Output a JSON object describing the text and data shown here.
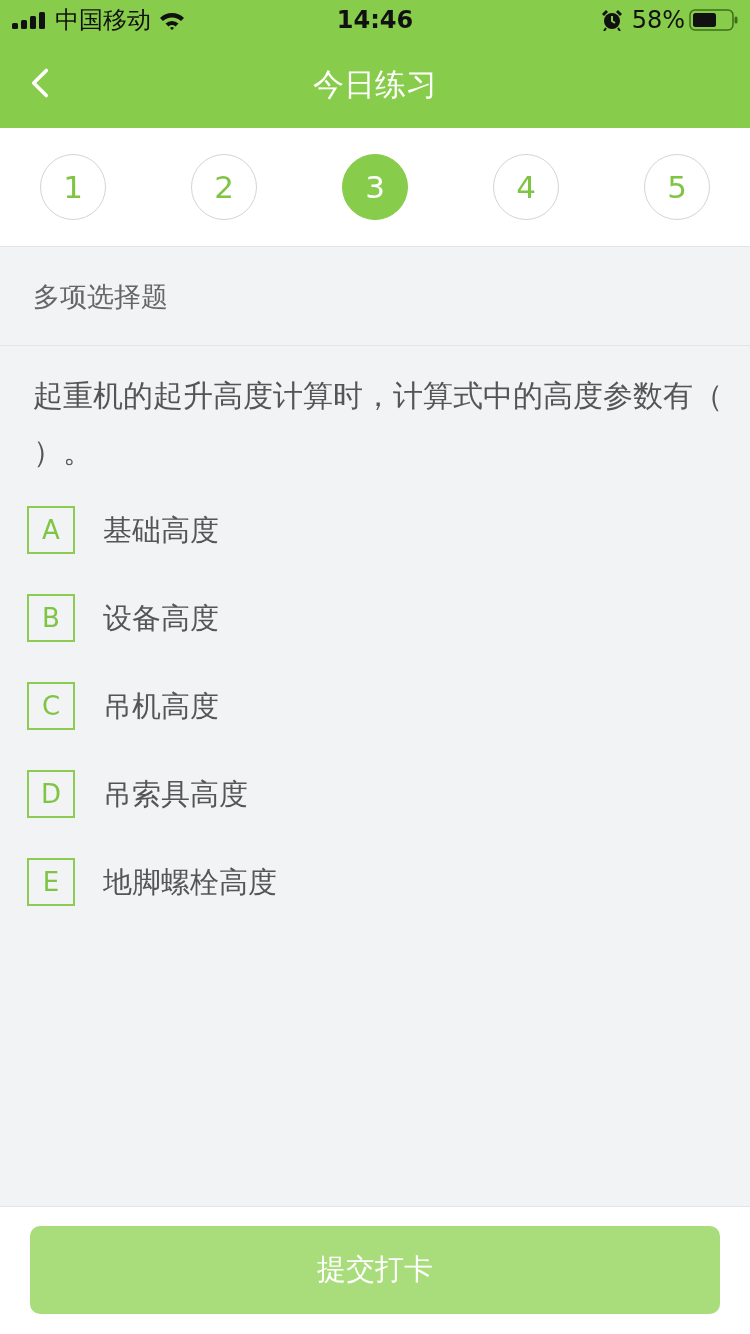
{
  "status_bar": {
    "carrier": "中国移动",
    "time": "14:46",
    "battery": "58%"
  },
  "nav": {
    "title": "今日练习"
  },
  "steps": [
    {
      "label": "1",
      "selected": false
    },
    {
      "label": "2",
      "selected": false
    },
    {
      "label": "3",
      "selected": true
    },
    {
      "label": "4",
      "selected": false
    },
    {
      "label": "5",
      "selected": false
    }
  ],
  "question": {
    "type_label": "多项选择题",
    "text": "起重机的起升高度计算时，计算式中的高度参数有（）。",
    "options": [
      {
        "letter": "A",
        "text": "基础高度",
        "selected": false
      },
      {
        "letter": "B",
        "text": "设备高度",
        "selected": false
      },
      {
        "letter": "C",
        "text": "吊机高度",
        "selected": false
      },
      {
        "letter": "D",
        "text": "吊索具高度",
        "selected": false
      },
      {
        "letter": "E",
        "text": "地脚螺栓高度",
        "selected": false
      }
    ]
  },
  "submit_button": {
    "label": "提交打卡",
    "disabled": true
  }
}
